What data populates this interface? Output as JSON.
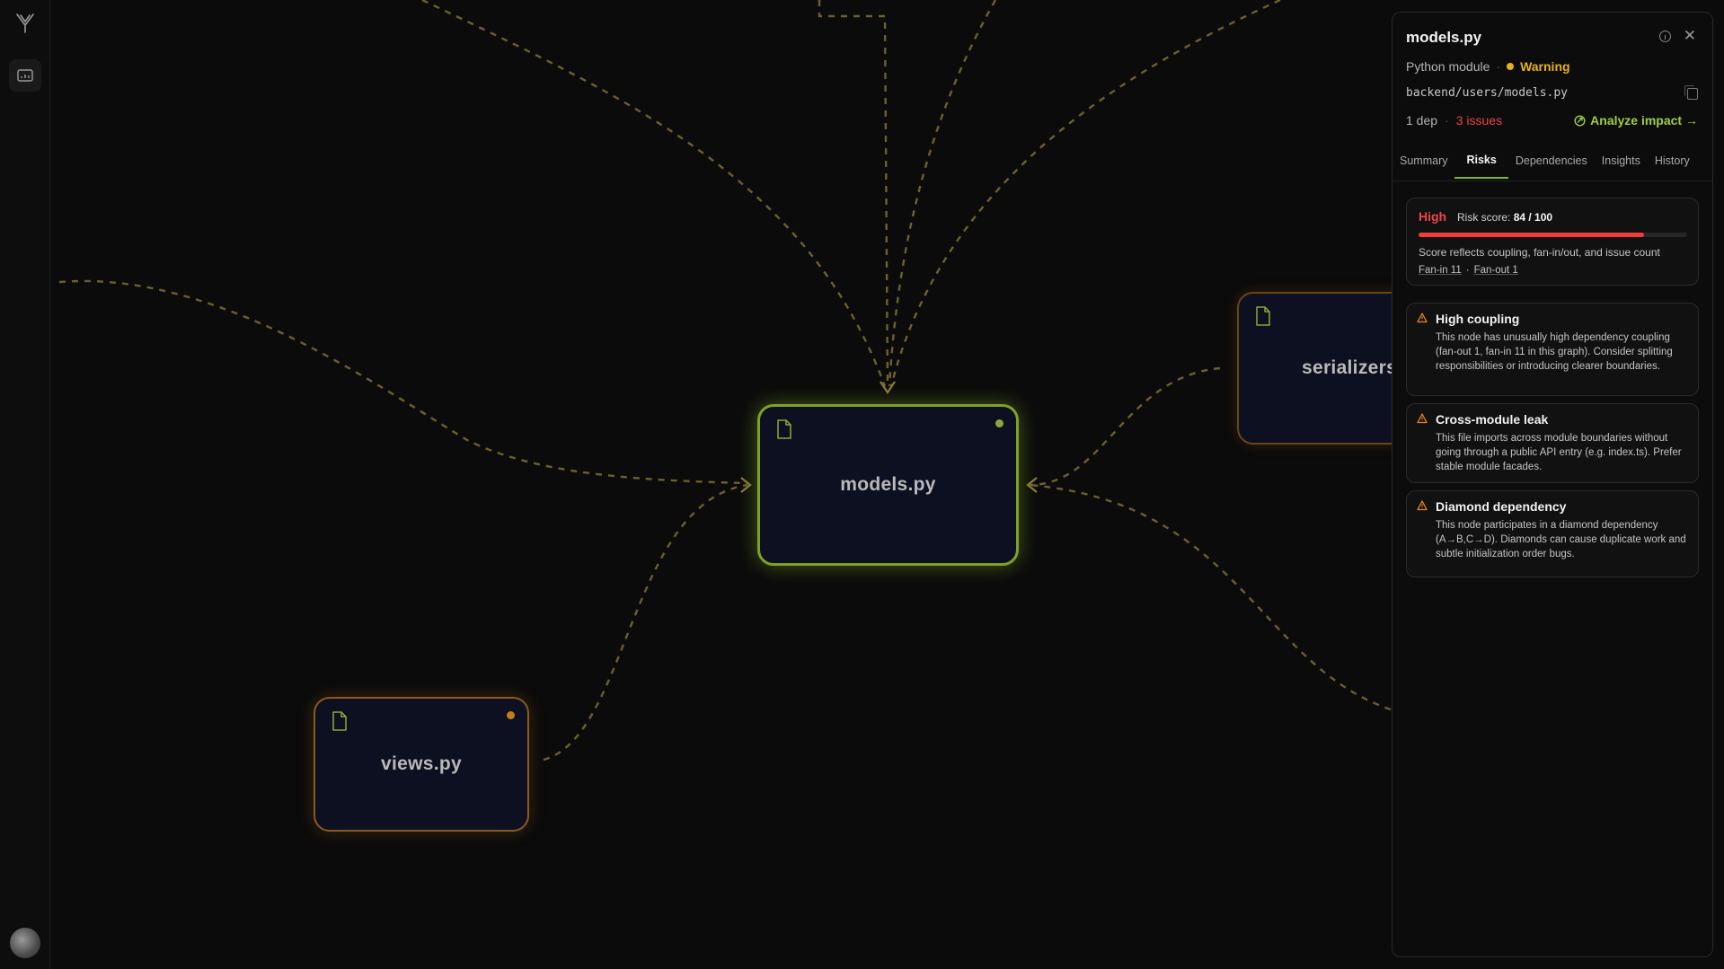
{
  "rail": {
    "logo_glyph": "Y",
    "items": [
      {
        "icon": "folder-graph-icon"
      }
    ],
    "avatar": "user-avatar"
  },
  "graph": {
    "nodes": [
      {
        "id": "models",
        "label": "models.py",
        "status": "selected"
      },
      {
        "id": "views",
        "label": "views.py",
        "status": "warning"
      },
      {
        "id": "serializers",
        "label": "serializers",
        "status": "warning"
      }
    ]
  },
  "panel": {
    "title": "models.py",
    "type": "Python module",
    "separator": "·",
    "status": "Warning",
    "path": "backend/users/models.py",
    "deps": "1 dep",
    "issues": "3 issues",
    "analyze_label": "Analyze impact →",
    "tabs": [
      {
        "label": "Summary",
        "active": false
      },
      {
        "label": "Risks",
        "active": true
      },
      {
        "label": "Dependencies",
        "active": false
      },
      {
        "label": "Insights",
        "active": false
      },
      {
        "label": "History",
        "active": false
      }
    ],
    "risk": {
      "level": "High",
      "score_label": "Risk score:",
      "score": "84 / 100",
      "score_value": 84,
      "score_max": 100,
      "note": "Score reflects coupling, fan-in/out, and issue count",
      "fan_in": "Fan-in 11",
      "fan_sep": "·",
      "fan_out": "Fan-out 1"
    },
    "issues_list": [
      {
        "title": "High coupling",
        "body": "This node has unusually high dependency coupling (fan-out 1, fan-in 11 in this graph). Consider splitting responsibilities or introducing clearer boundaries."
      },
      {
        "title": "Cross-module leak",
        "body": "This file imports across module boundaries without going through a public API entry (e.g. index.ts). Prefer stable module facades."
      },
      {
        "title": "Diamond dependency",
        "body": "This node participates in a diamond dependency (A→B,C→D). Diamonds can cause duplicate work and subtle initialization order bugs."
      }
    ]
  },
  "colors": {
    "accent_green": "#7fb92a",
    "warning": "#e8b021",
    "danger": "#ef4444",
    "edge": "#8a7a3a"
  }
}
